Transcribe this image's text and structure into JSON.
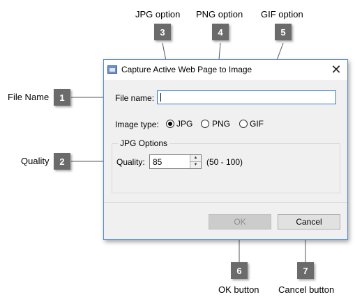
{
  "callouts": [
    {
      "num": "1",
      "label": "File Name"
    },
    {
      "num": "2",
      "label": "Quality"
    },
    {
      "num": "3",
      "label": "JPG option"
    },
    {
      "num": "4",
      "label": "PNG option"
    },
    {
      "num": "5",
      "label": "GIF option"
    },
    {
      "num": "6",
      "label": "OK button"
    },
    {
      "num": "7",
      "label": "Cancel button"
    }
  ],
  "dialog": {
    "title": "Capture Active Web Page to Image",
    "close_glyph": "✕",
    "file_name_label": "File name:",
    "file_name_value": "",
    "image_type_label": "Image type:",
    "image_types": [
      {
        "label": "JPG",
        "checked": true
      },
      {
        "label": "PNG",
        "checked": false
      },
      {
        "label": "GIF",
        "checked": false
      }
    ],
    "jpg_options_title": "JPG Options",
    "quality_label": "Quality:",
    "quality_value": "85",
    "quality_range": "(50 - 100)",
    "ok_label": "OK",
    "ok_enabled": false,
    "cancel_label": "Cancel"
  },
  "colors": {
    "badge": "#6b6b6b",
    "dialog_border": "#5b8fcf",
    "textbox_focus_border": "#2c7ad6"
  }
}
